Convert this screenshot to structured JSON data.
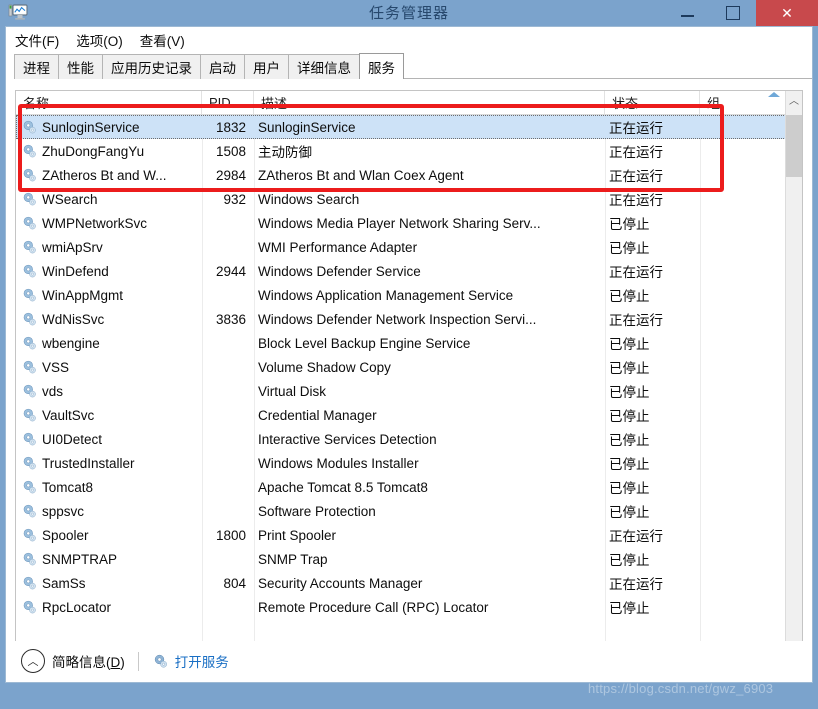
{
  "window": {
    "title": "任务管理器",
    "icon": "task-manager-icon",
    "minimize_label": "",
    "maximize_label": "",
    "close_label": "✕"
  },
  "menubar": {
    "items": [
      {
        "label": "文件(F)"
      },
      {
        "label": "选项(O)"
      },
      {
        "label": "查看(V)"
      }
    ]
  },
  "tabs": {
    "items": [
      {
        "label": "进程",
        "active": false
      },
      {
        "label": "性能",
        "active": false
      },
      {
        "label": "应用历史记录",
        "active": false
      },
      {
        "label": "启动",
        "active": false
      },
      {
        "label": "用户",
        "active": false
      },
      {
        "label": "详细信息",
        "active": false
      },
      {
        "label": "服务",
        "active": true
      }
    ]
  },
  "table": {
    "columns": [
      {
        "key": "name",
        "label": "名称"
      },
      {
        "key": "pid",
        "label": "PID"
      },
      {
        "key": "desc",
        "label": "描述"
      },
      {
        "key": "state",
        "label": "状态"
      },
      {
        "key": "group",
        "label": "组"
      }
    ],
    "sort_indicator": "ascending-arrow",
    "rows": [
      {
        "name": "SunloginService",
        "pid": "1832",
        "desc": "SunloginService",
        "state": "正在运行",
        "group": "",
        "selected": true
      },
      {
        "name": "ZhuDongFangYu",
        "pid": "1508",
        "desc": "主动防御",
        "state": "正在运行",
        "group": "",
        "selected": false
      },
      {
        "name": "ZAtheros Bt and W...",
        "pid": "2984",
        "desc": "ZAtheros Bt and Wlan Coex Agent",
        "state": "正在运行",
        "group": "",
        "selected": false
      },
      {
        "name": "WSearch",
        "pid": "932",
        "desc": "Windows Search",
        "state": "正在运行",
        "group": "",
        "selected": false
      },
      {
        "name": "WMPNetworkSvc",
        "pid": "",
        "desc": "Windows Media Player Network Sharing Serv...",
        "state": "已停止",
        "group": "",
        "selected": false
      },
      {
        "name": "wmiApSrv",
        "pid": "",
        "desc": "WMI Performance Adapter",
        "state": "已停止",
        "group": "",
        "selected": false
      },
      {
        "name": "WinDefend",
        "pid": "2944",
        "desc": "Windows Defender Service",
        "state": "正在运行",
        "group": "",
        "selected": false
      },
      {
        "name": "WinAppMgmt",
        "pid": "",
        "desc": "Windows Application Management Service",
        "state": "已停止",
        "group": "",
        "selected": false
      },
      {
        "name": "WdNisSvc",
        "pid": "3836",
        "desc": "Windows Defender Network Inspection Servi...",
        "state": "正在运行",
        "group": "",
        "selected": false
      },
      {
        "name": "wbengine",
        "pid": "",
        "desc": "Block Level Backup Engine Service",
        "state": "已停止",
        "group": "",
        "selected": false
      },
      {
        "name": "VSS",
        "pid": "",
        "desc": "Volume Shadow Copy",
        "state": "已停止",
        "group": "",
        "selected": false
      },
      {
        "name": "vds",
        "pid": "",
        "desc": "Virtual Disk",
        "state": "已停止",
        "group": "",
        "selected": false
      },
      {
        "name": "VaultSvc",
        "pid": "",
        "desc": "Credential Manager",
        "state": "已停止",
        "group": "",
        "selected": false
      },
      {
        "name": "UI0Detect",
        "pid": "",
        "desc": "Interactive Services Detection",
        "state": "已停止",
        "group": "",
        "selected": false
      },
      {
        "name": "TrustedInstaller",
        "pid": "",
        "desc": "Windows Modules Installer",
        "state": "已停止",
        "group": "",
        "selected": false
      },
      {
        "name": "Tomcat8",
        "pid": "",
        "desc": "Apache Tomcat 8.5 Tomcat8",
        "state": "已停止",
        "group": "",
        "selected": false
      },
      {
        "name": "sppsvc",
        "pid": "",
        "desc": "Software Protection",
        "state": "已停止",
        "group": "",
        "selected": false
      },
      {
        "name": "Spooler",
        "pid": "1800",
        "desc": "Print Spooler",
        "state": "正在运行",
        "group": "",
        "selected": false
      },
      {
        "name": "SNMPTRAP",
        "pid": "",
        "desc": "SNMP Trap",
        "state": "已停止",
        "group": "",
        "selected": false
      },
      {
        "name": "SamSs",
        "pid": "804",
        "desc": "Security Accounts Manager",
        "state": "正在运行",
        "group": "",
        "selected": false
      },
      {
        "name": "RpcLocator",
        "pid": "",
        "desc": "Remote Procedure Call (RPC) Locator",
        "state": "已停止",
        "group": "",
        "selected": false
      }
    ]
  },
  "scrollbar": {
    "up_glyph": "︿",
    "down_glyph": "﹀"
  },
  "bottombar": {
    "fewer_details_label": "简略信息(D)",
    "fewer_details_prefix": "简略信息(",
    "fewer_details_accel": "D",
    "fewer_details_suffix": ")",
    "chevron_glyph": "︿",
    "open_services_label": "打开服务"
  },
  "annotation": {
    "color": "#ec1c1c",
    "shape": "rectangle"
  },
  "watermark": {
    "text": "https://blog.csdn.net/gwz_6903"
  }
}
